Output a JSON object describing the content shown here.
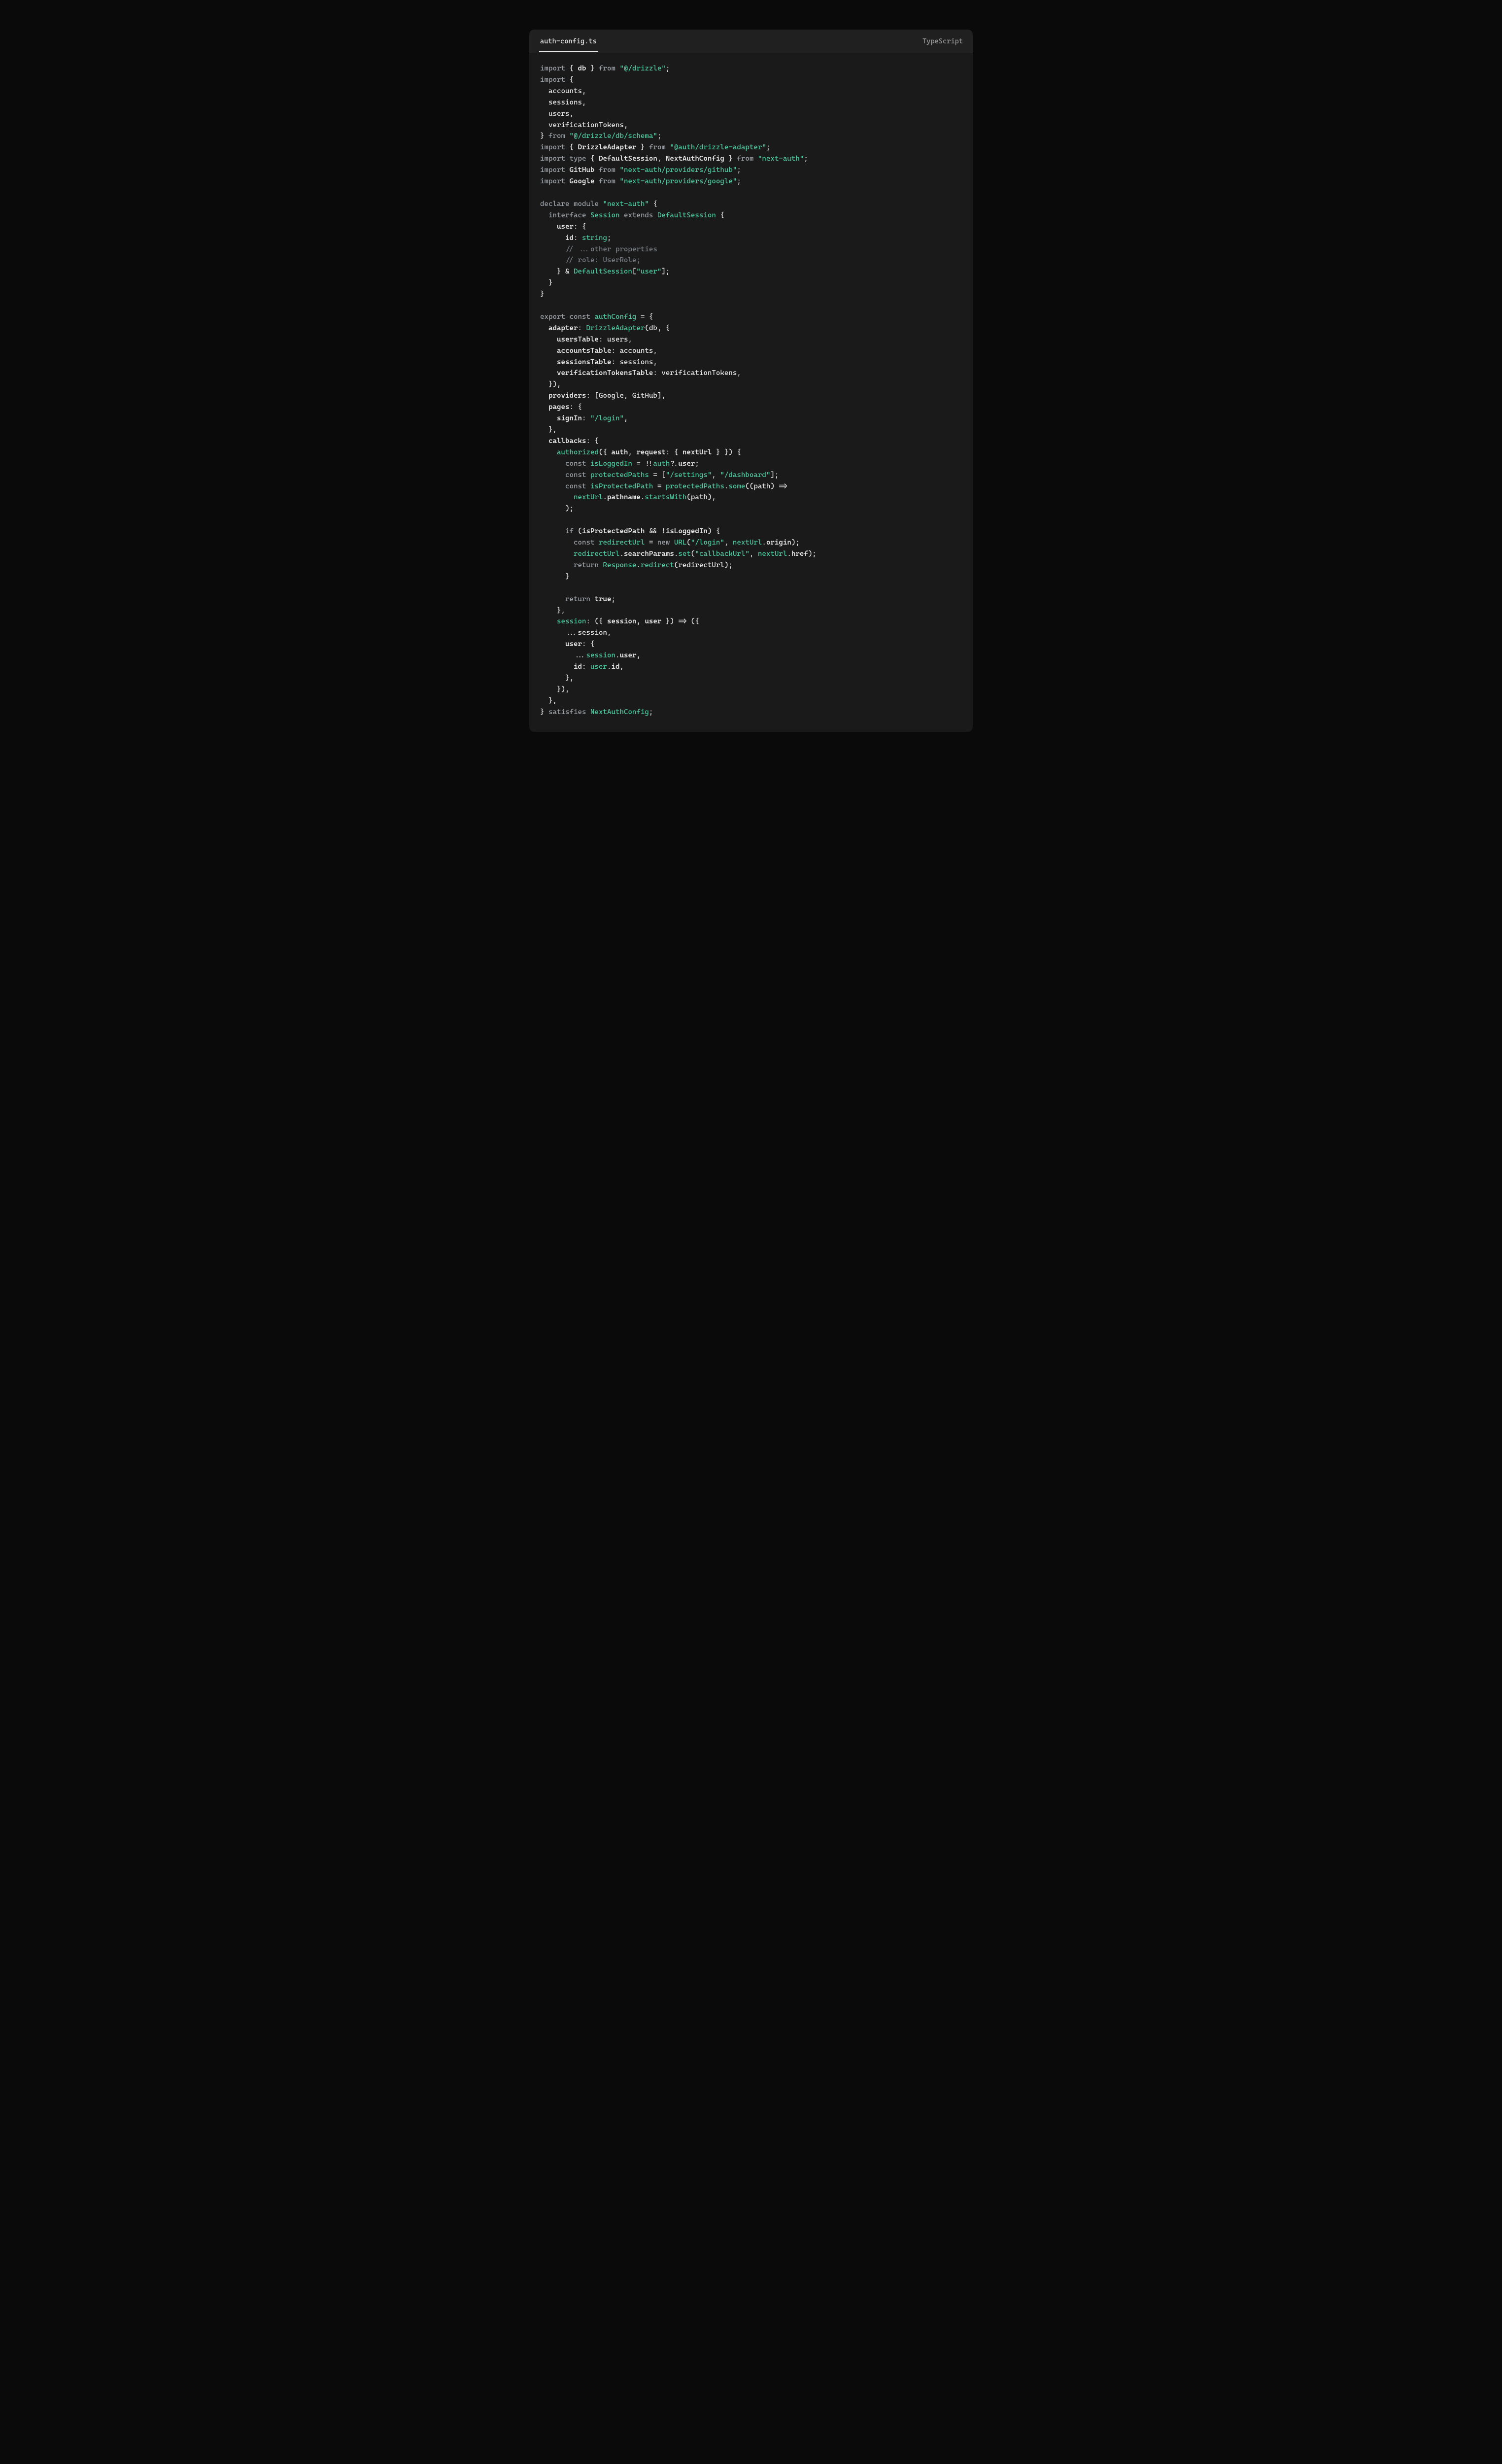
{
  "header": {
    "filename": "auth-config.ts",
    "language": "TypeScript"
  },
  "code": {
    "raw": "import { db } from \"@/drizzle\";\nimport {\n  accounts,\n  sessions,\n  users,\n  verificationTokens,\n} from \"@/drizzle/db/schema\";\nimport { DrizzleAdapter } from \"@auth/drizzle-adapter\";\nimport type { DefaultSession, NextAuthConfig } from \"next-auth\";\nimport GitHub from \"next-auth/providers/github\";\nimport Google from \"next-auth/providers/google\";\n\ndeclare module \"next-auth\" {\n  interface Session extends DefaultSession {\n    user: {\n      id: string;\n      // ...other properties\n      // role: UserRole;\n    } & DefaultSession[\"user\"];\n  }\n}\n\nexport const authConfig = {\n  adapter: DrizzleAdapter(db, {\n    usersTable: users,\n    accountsTable: accounts,\n    sessionsTable: sessions,\n    verificationTokensTable: verificationTokens,\n  }),\n  providers: [Google, GitHub],\n  pages: {\n    signIn: \"/login\",\n  },\n  callbacks: {\n    authorized({ auth, request: { nextUrl } }) {\n      const isLoggedIn = !!auth?.user;\n      const protectedPaths = [\"/settings\", \"/dashboard\"];\n      const isProtectedPath = protectedPaths.some((path) =>\n        nextUrl.pathname.startsWith(path),\n      );\n\n      if (isProtectedPath && !isLoggedIn) {\n        const redirectUrl = new URL(\"/login\", nextUrl.origin);\n        redirectUrl.searchParams.set(\"callbackUrl\", nextUrl.href);\n        return Response.redirect(redirectUrl);\n      }\n\n      return true;\n    },\n    session: ({ session, user }) => ({\n      ...session,\n      user: {\n        ...session.user,\n        id: user.id,\n      },\n    }),\n  },\n} satisfies NextAuthConfig;",
    "tokens": [
      [
        [
          "kw",
          "import"
        ],
        [
          "pn",
          " { "
        ],
        [
          "id bold",
          "db"
        ],
        [
          "pn",
          " } "
        ],
        [
          "kw",
          "from"
        ],
        [
          "pn",
          " "
        ],
        [
          "str",
          "\"@/drizzle\""
        ],
        [
          "pn",
          ";"
        ]
      ],
      [
        [
          "kw",
          "import"
        ],
        [
          "pn",
          " {"
        ]
      ],
      [
        [
          "pn",
          "  "
        ],
        [
          "id",
          "accounts"
        ],
        [
          "pn",
          ","
        ]
      ],
      [
        [
          "pn",
          "  "
        ],
        [
          "id",
          "sessions"
        ],
        [
          "pn",
          ","
        ]
      ],
      [
        [
          "pn",
          "  "
        ],
        [
          "id",
          "users"
        ],
        [
          "pn",
          ","
        ]
      ],
      [
        [
          "pn",
          "  "
        ],
        [
          "id",
          "verificationTokens"
        ],
        [
          "pn",
          ","
        ]
      ],
      [
        [
          "pn",
          "} "
        ],
        [
          "kw",
          "from"
        ],
        [
          "pn",
          " "
        ],
        [
          "str",
          "\"@/drizzle/db/schema\""
        ],
        [
          "pn",
          ";"
        ]
      ],
      [
        [
          "kw",
          "import"
        ],
        [
          "pn",
          " { "
        ],
        [
          "id bold",
          "DrizzleAdapter"
        ],
        [
          "pn",
          " } "
        ],
        [
          "kw",
          "from"
        ],
        [
          "pn",
          " "
        ],
        [
          "str",
          "\"@auth/drizzle-adapter\""
        ],
        [
          "pn",
          ";"
        ]
      ],
      [
        [
          "kw",
          "import"
        ],
        [
          "pn",
          " "
        ],
        [
          "kw",
          "type"
        ],
        [
          "pn",
          " { "
        ],
        [
          "id bold",
          "DefaultSession"
        ],
        [
          "pn",
          ", "
        ],
        [
          "id bold",
          "NextAuthConfig"
        ],
        [
          "pn",
          " } "
        ],
        [
          "kw",
          "from"
        ],
        [
          "pn",
          " "
        ],
        [
          "str",
          "\"next-auth\""
        ],
        [
          "pn",
          ";"
        ]
      ],
      [
        [
          "kw",
          "import"
        ],
        [
          "pn",
          " "
        ],
        [
          "id bold",
          "GitHub"
        ],
        [
          "pn",
          " "
        ],
        [
          "kw",
          "from"
        ],
        [
          "pn",
          " "
        ],
        [
          "str",
          "\"next-auth/providers/github\""
        ],
        [
          "pn",
          ";"
        ]
      ],
      [
        [
          "kw",
          "import"
        ],
        [
          "pn",
          " "
        ],
        [
          "id bold",
          "Google"
        ],
        [
          "pn",
          " "
        ],
        [
          "kw",
          "from"
        ],
        [
          "pn",
          " "
        ],
        [
          "str",
          "\"next-auth/providers/google\""
        ],
        [
          "pn",
          ";"
        ]
      ],
      [],
      [
        [
          "kw",
          "declare"
        ],
        [
          "pn",
          " "
        ],
        [
          "kw",
          "module"
        ],
        [
          "pn",
          " "
        ],
        [
          "str",
          "\"next-auth\""
        ],
        [
          "pn",
          " {"
        ]
      ],
      [
        [
          "pn",
          "  "
        ],
        [
          "kw",
          "interface"
        ],
        [
          "pn",
          " "
        ],
        [
          "fn",
          "Session"
        ],
        [
          "pn",
          " "
        ],
        [
          "kw",
          "extends"
        ],
        [
          "pn",
          " "
        ],
        [
          "fn",
          "DefaultSession"
        ],
        [
          "pn",
          " {"
        ]
      ],
      [
        [
          "pn",
          "    "
        ],
        [
          "id bold",
          "user"
        ],
        [
          "pn",
          ": {"
        ]
      ],
      [
        [
          "pn",
          "      "
        ],
        [
          "id bold",
          "id"
        ],
        [
          "pn",
          ": "
        ],
        [
          "fn",
          "string"
        ],
        [
          "pn",
          ";"
        ]
      ],
      [
        [
          "pn",
          "      "
        ],
        [
          "cmt",
          "// ...other properties"
        ]
      ],
      [
        [
          "pn",
          "      "
        ],
        [
          "cmt",
          "// role: UserRole;"
        ]
      ],
      [
        [
          "pn",
          "    } & "
        ],
        [
          "fn",
          "DefaultSession"
        ],
        [
          "pn",
          "["
        ],
        [
          "str",
          "\"user\""
        ],
        [
          "pn",
          "];"
        ]
      ],
      [
        [
          "pn",
          "  }"
        ]
      ],
      [
        [
          "pn",
          "}"
        ]
      ],
      [],
      [
        [
          "kw",
          "export"
        ],
        [
          "pn",
          " "
        ],
        [
          "kw",
          "const"
        ],
        [
          "pn",
          " "
        ],
        [
          "fn",
          "authConfig"
        ],
        [
          "pn",
          " = {"
        ]
      ],
      [
        [
          "pn",
          "  "
        ],
        [
          "id bold",
          "adapter"
        ],
        [
          "pn",
          ": "
        ],
        [
          "fn",
          "DrizzleAdapter"
        ],
        [
          "pn",
          "("
        ],
        [
          "id",
          "db"
        ],
        [
          "pn",
          ", {"
        ]
      ],
      [
        [
          "pn",
          "    "
        ],
        [
          "id bold",
          "usersTable"
        ],
        [
          "pn",
          ": "
        ],
        [
          "id",
          "users"
        ],
        [
          "pn",
          ","
        ]
      ],
      [
        [
          "pn",
          "    "
        ],
        [
          "id bold",
          "accountsTable"
        ],
        [
          "pn",
          ": "
        ],
        [
          "id",
          "accounts"
        ],
        [
          "pn",
          ","
        ]
      ],
      [
        [
          "pn",
          "    "
        ],
        [
          "id bold",
          "sessionsTable"
        ],
        [
          "pn",
          ": "
        ],
        [
          "id",
          "sessions"
        ],
        [
          "pn",
          ","
        ]
      ],
      [
        [
          "pn",
          "    "
        ],
        [
          "id bold",
          "verificationTokensTable"
        ],
        [
          "pn",
          ": "
        ],
        [
          "id",
          "verificationTokens"
        ],
        [
          "pn",
          ","
        ]
      ],
      [
        [
          "pn",
          "  }),"
        ]
      ],
      [
        [
          "pn",
          "  "
        ],
        [
          "id bold",
          "providers"
        ],
        [
          "pn",
          ": ["
        ],
        [
          "id",
          "Google"
        ],
        [
          "pn",
          ", "
        ],
        [
          "id",
          "GitHub"
        ],
        [
          "pn",
          "],"
        ]
      ],
      [
        [
          "pn",
          "  "
        ],
        [
          "id bold",
          "pages"
        ],
        [
          "pn",
          ": {"
        ]
      ],
      [
        [
          "pn",
          "    "
        ],
        [
          "id bold",
          "signIn"
        ],
        [
          "pn",
          ": "
        ],
        [
          "str",
          "\"/login\""
        ],
        [
          "pn",
          ","
        ]
      ],
      [
        [
          "pn",
          "  },"
        ]
      ],
      [
        [
          "pn",
          "  "
        ],
        [
          "id bold",
          "callbacks"
        ],
        [
          "pn",
          ": {"
        ]
      ],
      [
        [
          "pn",
          "    "
        ],
        [
          "fn",
          "authorized"
        ],
        [
          "pn",
          "({ "
        ],
        [
          "id bold",
          "auth"
        ],
        [
          "pn",
          ", "
        ],
        [
          "id bold",
          "request"
        ],
        [
          "pn",
          ": { "
        ],
        [
          "id bold",
          "nextUrl"
        ],
        [
          "pn",
          " } }) {"
        ]
      ],
      [
        [
          "pn",
          "      "
        ],
        [
          "kw",
          "const"
        ],
        [
          "pn",
          " "
        ],
        [
          "fn",
          "isLoggedIn"
        ],
        [
          "pn",
          " = !!"
        ],
        [
          "fn",
          "auth"
        ],
        [
          "pn",
          "?."
        ],
        [
          "id bold",
          "user"
        ],
        [
          "pn",
          ";"
        ]
      ],
      [
        [
          "pn",
          "      "
        ],
        [
          "kw",
          "const"
        ],
        [
          "pn",
          " "
        ],
        [
          "fn",
          "protectedPaths"
        ],
        [
          "pn",
          " = ["
        ],
        [
          "str",
          "\"/settings\""
        ],
        [
          "pn",
          ", "
        ],
        [
          "str",
          "\"/dashboard\""
        ],
        [
          "pn",
          "];"
        ]
      ],
      [
        [
          "pn",
          "      "
        ],
        [
          "kw",
          "const"
        ],
        [
          "pn",
          " "
        ],
        [
          "fn",
          "isProtectedPath"
        ],
        [
          "pn",
          " = "
        ],
        [
          "fn",
          "protectedPaths"
        ],
        [
          "pn",
          "."
        ],
        [
          "fn",
          "some"
        ],
        [
          "pn",
          "(("
        ],
        [
          "id",
          "path"
        ],
        [
          "pn",
          ") =>"
        ]
      ],
      [
        [
          "pn",
          "        "
        ],
        [
          "fn",
          "nextUrl"
        ],
        [
          "pn",
          "."
        ],
        [
          "id bold",
          "pathname"
        ],
        [
          "pn",
          "."
        ],
        [
          "fn",
          "startsWith"
        ],
        [
          "pn",
          "("
        ],
        [
          "id",
          "path"
        ],
        [
          "pn",
          "),"
        ]
      ],
      [
        [
          "pn",
          "      );"
        ]
      ],
      [],
      [
        [
          "pn",
          "      "
        ],
        [
          "kw",
          "if"
        ],
        [
          "pn",
          " ("
        ],
        [
          "id bold",
          "isProtectedPath"
        ],
        [
          "pn",
          " && !"
        ],
        [
          "id bold",
          "isLoggedIn"
        ],
        [
          "pn",
          ") {"
        ]
      ],
      [
        [
          "pn",
          "        "
        ],
        [
          "kw",
          "const"
        ],
        [
          "pn",
          " "
        ],
        [
          "fn",
          "redirectUrl"
        ],
        [
          "pn",
          " = "
        ],
        [
          "kw",
          "new"
        ],
        [
          "pn",
          " "
        ],
        [
          "fn",
          "URL"
        ],
        [
          "pn",
          "("
        ],
        [
          "str",
          "\"/login\""
        ],
        [
          "pn",
          ", "
        ],
        [
          "fn",
          "nextUrl"
        ],
        [
          "pn",
          "."
        ],
        [
          "id bold",
          "origin"
        ],
        [
          "pn",
          ");"
        ]
      ],
      [
        [
          "pn",
          "        "
        ],
        [
          "fn",
          "redirectUrl"
        ],
        [
          "pn",
          "."
        ],
        [
          "id bold",
          "searchParams"
        ],
        [
          "pn",
          "."
        ],
        [
          "fn",
          "set"
        ],
        [
          "pn",
          "("
        ],
        [
          "str",
          "\"callbackUrl\""
        ],
        [
          "pn",
          ", "
        ],
        [
          "fn",
          "nextUrl"
        ],
        [
          "pn",
          "."
        ],
        [
          "id bold",
          "href"
        ],
        [
          "pn",
          ");"
        ]
      ],
      [
        [
          "pn",
          "        "
        ],
        [
          "kw",
          "return"
        ],
        [
          "pn",
          " "
        ],
        [
          "fn",
          "Response"
        ],
        [
          "pn",
          "."
        ],
        [
          "fn",
          "redirect"
        ],
        [
          "pn",
          "("
        ],
        [
          "id",
          "redirectUrl"
        ],
        [
          "pn",
          ");"
        ]
      ],
      [
        [
          "pn",
          "      }"
        ]
      ],
      [],
      [
        [
          "pn",
          "      "
        ],
        [
          "kw",
          "return"
        ],
        [
          "pn",
          " "
        ],
        [
          "id bold",
          "true"
        ],
        [
          "pn",
          ";"
        ]
      ],
      [
        [
          "pn",
          "    },"
        ]
      ],
      [
        [
          "pn",
          "    "
        ],
        [
          "fn",
          "session"
        ],
        [
          "pn",
          ": ({ "
        ],
        [
          "id bold",
          "session"
        ],
        [
          "pn",
          ", "
        ],
        [
          "id bold",
          "user"
        ],
        [
          "pn",
          " }) => ({"
        ]
      ],
      [
        [
          "pn",
          "      ..."
        ],
        [
          "id",
          "session"
        ],
        [
          "pn",
          ","
        ]
      ],
      [
        [
          "pn",
          "      "
        ],
        [
          "id bold",
          "user"
        ],
        [
          "pn",
          ": {"
        ]
      ],
      [
        [
          "pn",
          "        ..."
        ],
        [
          "fn",
          "session"
        ],
        [
          "pn",
          "."
        ],
        [
          "id bold",
          "user"
        ],
        [
          "pn",
          ","
        ]
      ],
      [
        [
          "pn",
          "        "
        ],
        [
          "id bold",
          "id"
        ],
        [
          "pn",
          ": "
        ],
        [
          "fn",
          "user"
        ],
        [
          "pn",
          "."
        ],
        [
          "id bold",
          "id"
        ],
        [
          "pn",
          ","
        ]
      ],
      [
        [
          "pn",
          "      },"
        ]
      ],
      [
        [
          "pn",
          "    }),"
        ]
      ],
      [
        [
          "pn",
          "  },"
        ]
      ],
      [
        [
          "pn",
          "} "
        ],
        [
          "kw",
          "satisfies"
        ],
        [
          "pn",
          " "
        ],
        [
          "fn",
          "NextAuthConfig"
        ],
        [
          "pn",
          ";"
        ]
      ]
    ]
  }
}
